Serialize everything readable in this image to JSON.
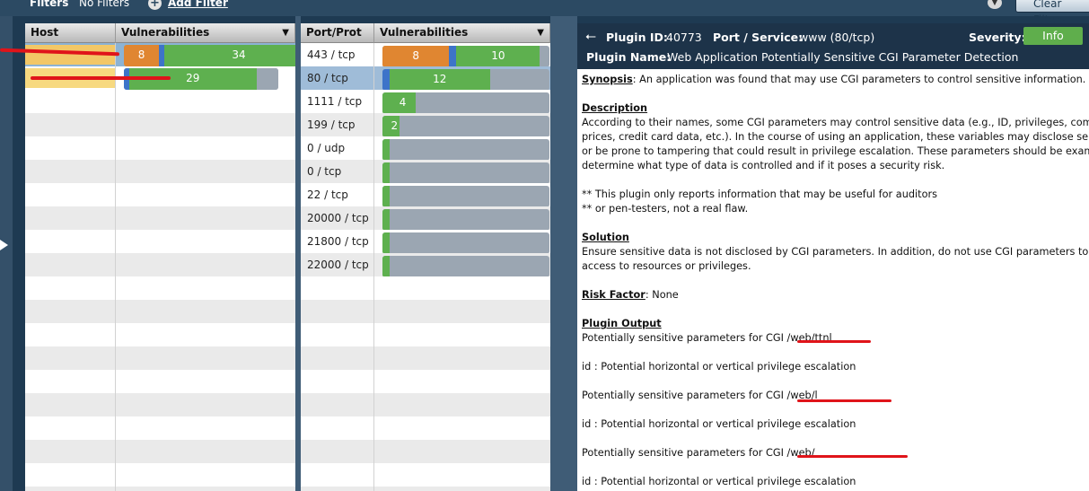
{
  "filters": {
    "label": "Filters",
    "value": "No Filters",
    "add_label": "Add Filter",
    "clear_label": "Clear Filters"
  },
  "hosts": {
    "col_host": "Host",
    "col_vulns": "Vulnerabilities",
    "rows": [
      {
        "name": "",
        "medium": 8,
        "info": 34
      },
      {
        "name": "",
        "info": 29
      }
    ]
  },
  "ports": {
    "col_port": "Port/Prot",
    "col_vulns": "Vulnerabilities",
    "rows": [
      {
        "port": "443 / tcp",
        "medium": "8",
        "info": "10"
      },
      {
        "port": "80 / tcp",
        "info": "12"
      },
      {
        "port": "1111 / tcp",
        "info": "4"
      },
      {
        "port": "199 / tcp",
        "info": "2"
      },
      {
        "port": "0 / udp"
      },
      {
        "port": "0 / tcp"
      },
      {
        "port": "22 / tcp"
      },
      {
        "port": "20000 / tcp"
      },
      {
        "port": "21800 / tcp"
      },
      {
        "port": "22000 / tcp"
      }
    ]
  },
  "plugin": {
    "id_label": "Plugin ID:",
    "id": "40773",
    "port_label": "Port / Service:",
    "port": "www (80/tcp)",
    "severity_label": "Severity:",
    "severity": "Info",
    "name_label": "Plugin Name:",
    "name": "Web Application Potentially Sensitive CGI Parameter Detection",
    "synopsis_label": "Synopsis",
    "synopsis": ": An application was found that may use CGI parameters to control sensitive information.",
    "description_label": "Description",
    "description_lines": [
      "According to their names, some CGI parameters may control sensitive data (e.g., ID, privileges, commands,",
      "prices, credit card data, etc.). In the course of using an application, these variables may disclose sensitive d",
      "or be prone to tampering that could result in privilege escalation. These parameters should be examined to",
      "determine what type of data is controlled and if it poses a security risk."
    ],
    "note_lines": [
      "** This plugin only reports information that may be useful for auditors",
      "** or pen-testers, not a real flaw."
    ],
    "solution_label": "Solution",
    "solution_lines": [
      "Ensure sensitive data is not disclosed by CGI parameters. In addition, do not use CGI parameters to control",
      "access to resources or privileges."
    ],
    "risk_label": "Risk Factor",
    "risk": ": None",
    "output_label": "Plugin Output",
    "output_lines": [
      "Potentially sensitive parameters for CGI /web/ttnl",
      "id : Potential horizontal or vertical privilege escalation",
      "Potentially sensitive parameters for CGI /web/l",
      "id : Potential horizontal or vertical privilege escalation",
      "Potentially sensitive parameters for CGI /web/",
      "id : Potential horizontal or vertical privilege escalation"
    ]
  }
}
